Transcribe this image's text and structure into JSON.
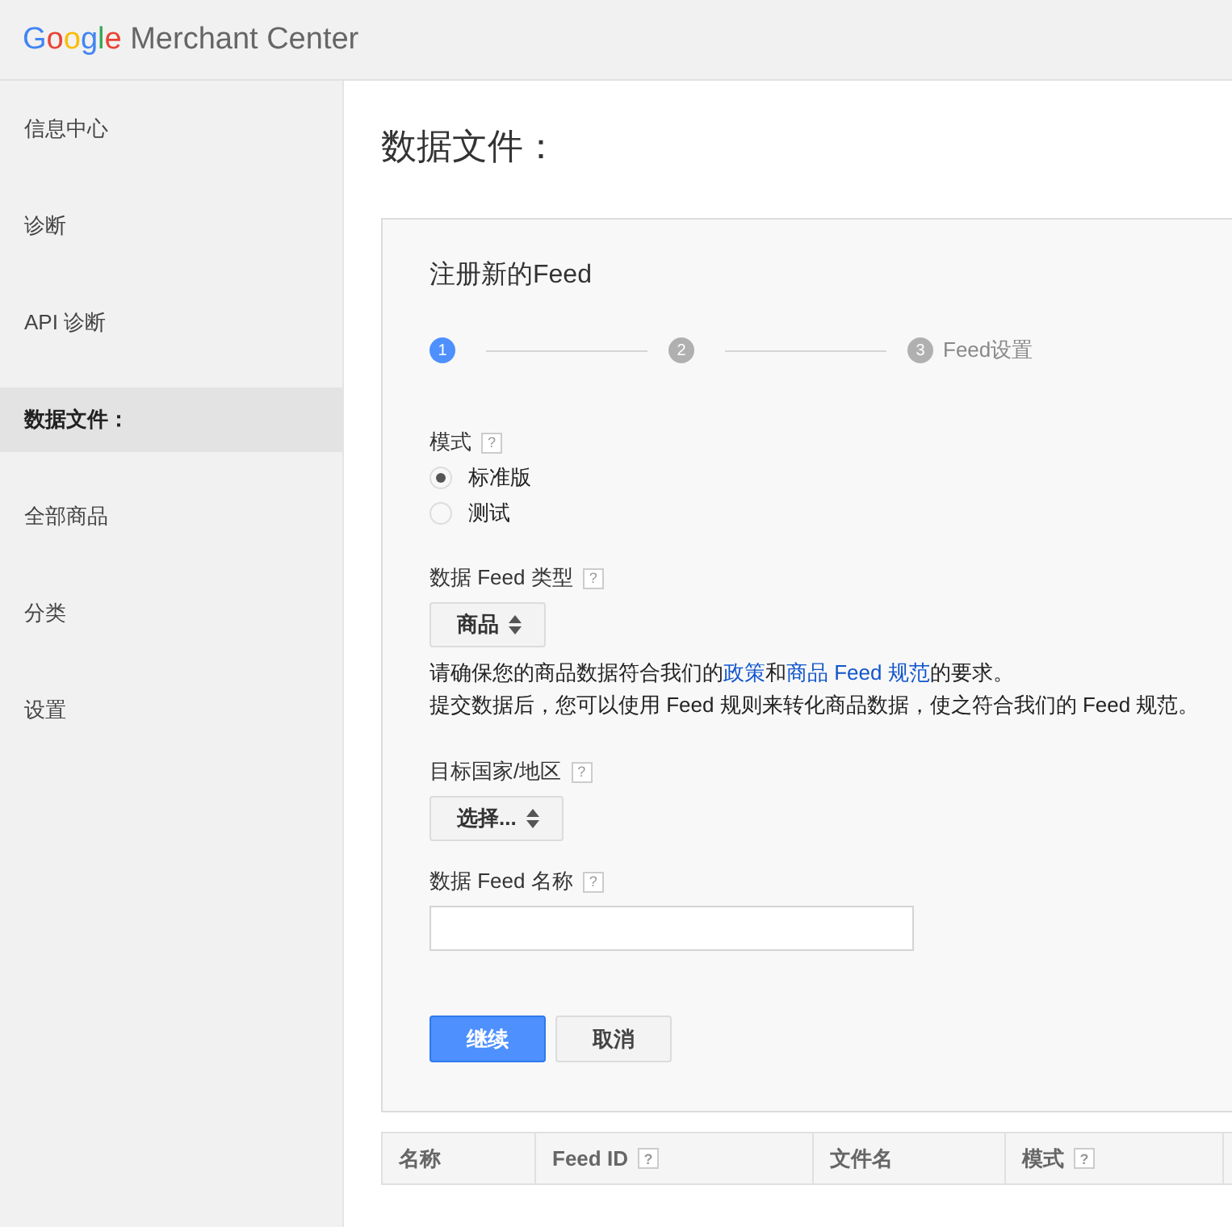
{
  "header": {
    "logo_brand": "Google",
    "logo_product": "Merchant Center"
  },
  "sidebar": {
    "items": [
      {
        "label": "信息中心",
        "selected": false
      },
      {
        "label": "诊断",
        "selected": false
      },
      {
        "label": "API 诊断",
        "selected": false
      },
      {
        "label": "数据文件：",
        "selected": true
      },
      {
        "label": "全部商品",
        "selected": false
      },
      {
        "label": "分类",
        "selected": false
      },
      {
        "label": "设置",
        "selected": false
      }
    ]
  },
  "page_title": "数据文件：",
  "form": {
    "title": "注册新的Feed",
    "steps": [
      {
        "number": "1",
        "selected": true
      },
      {
        "number": "2",
        "selected": false
      },
      {
        "number": "3",
        "label": "Feed设置",
        "selected": false
      }
    ],
    "mode": {
      "label": "模式",
      "help": "?",
      "options": [
        {
          "label": "标准版",
          "selected": true
        },
        {
          "label": "测试",
          "selected": false
        }
      ]
    },
    "feed_type": {
      "label": "数据 Feed 类型",
      "help": "?",
      "value": "商品"
    },
    "notice": [
      [
        {
          "kind": "text",
          "text": "请确保您的商品数据符合我们的"
        },
        {
          "kind": "link",
          "text": "政策"
        },
        {
          "kind": "text",
          "text": "和"
        },
        {
          "kind": "link",
          "text": "商品 Feed 规范"
        },
        {
          "kind": "text",
          "text": "的要求。"
        }
      ],
      [
        {
          "kind": "text",
          "text": "提交数据后，您可以使用 Feed 规则来转化商品数据，使之符合我们的 Feed 规范。"
        }
      ]
    ],
    "country": {
      "label": "目标国家/地区",
      "help": "?",
      "value": "选择..."
    },
    "feed_name": {
      "label": "数据 Feed 名称",
      "help": "?"
    },
    "buttons": [
      {
        "label": "继续",
        "kind": "primary"
      },
      {
        "label": "取消",
        "kind": "secondary"
      }
    ]
  },
  "table": {
    "columns": [
      {
        "label": "名称"
      },
      {
        "label": "Feed ID",
        "help": "?"
      },
      {
        "label": "文件名"
      },
      {
        "label": "模式",
        "help": "?"
      }
    ]
  }
}
